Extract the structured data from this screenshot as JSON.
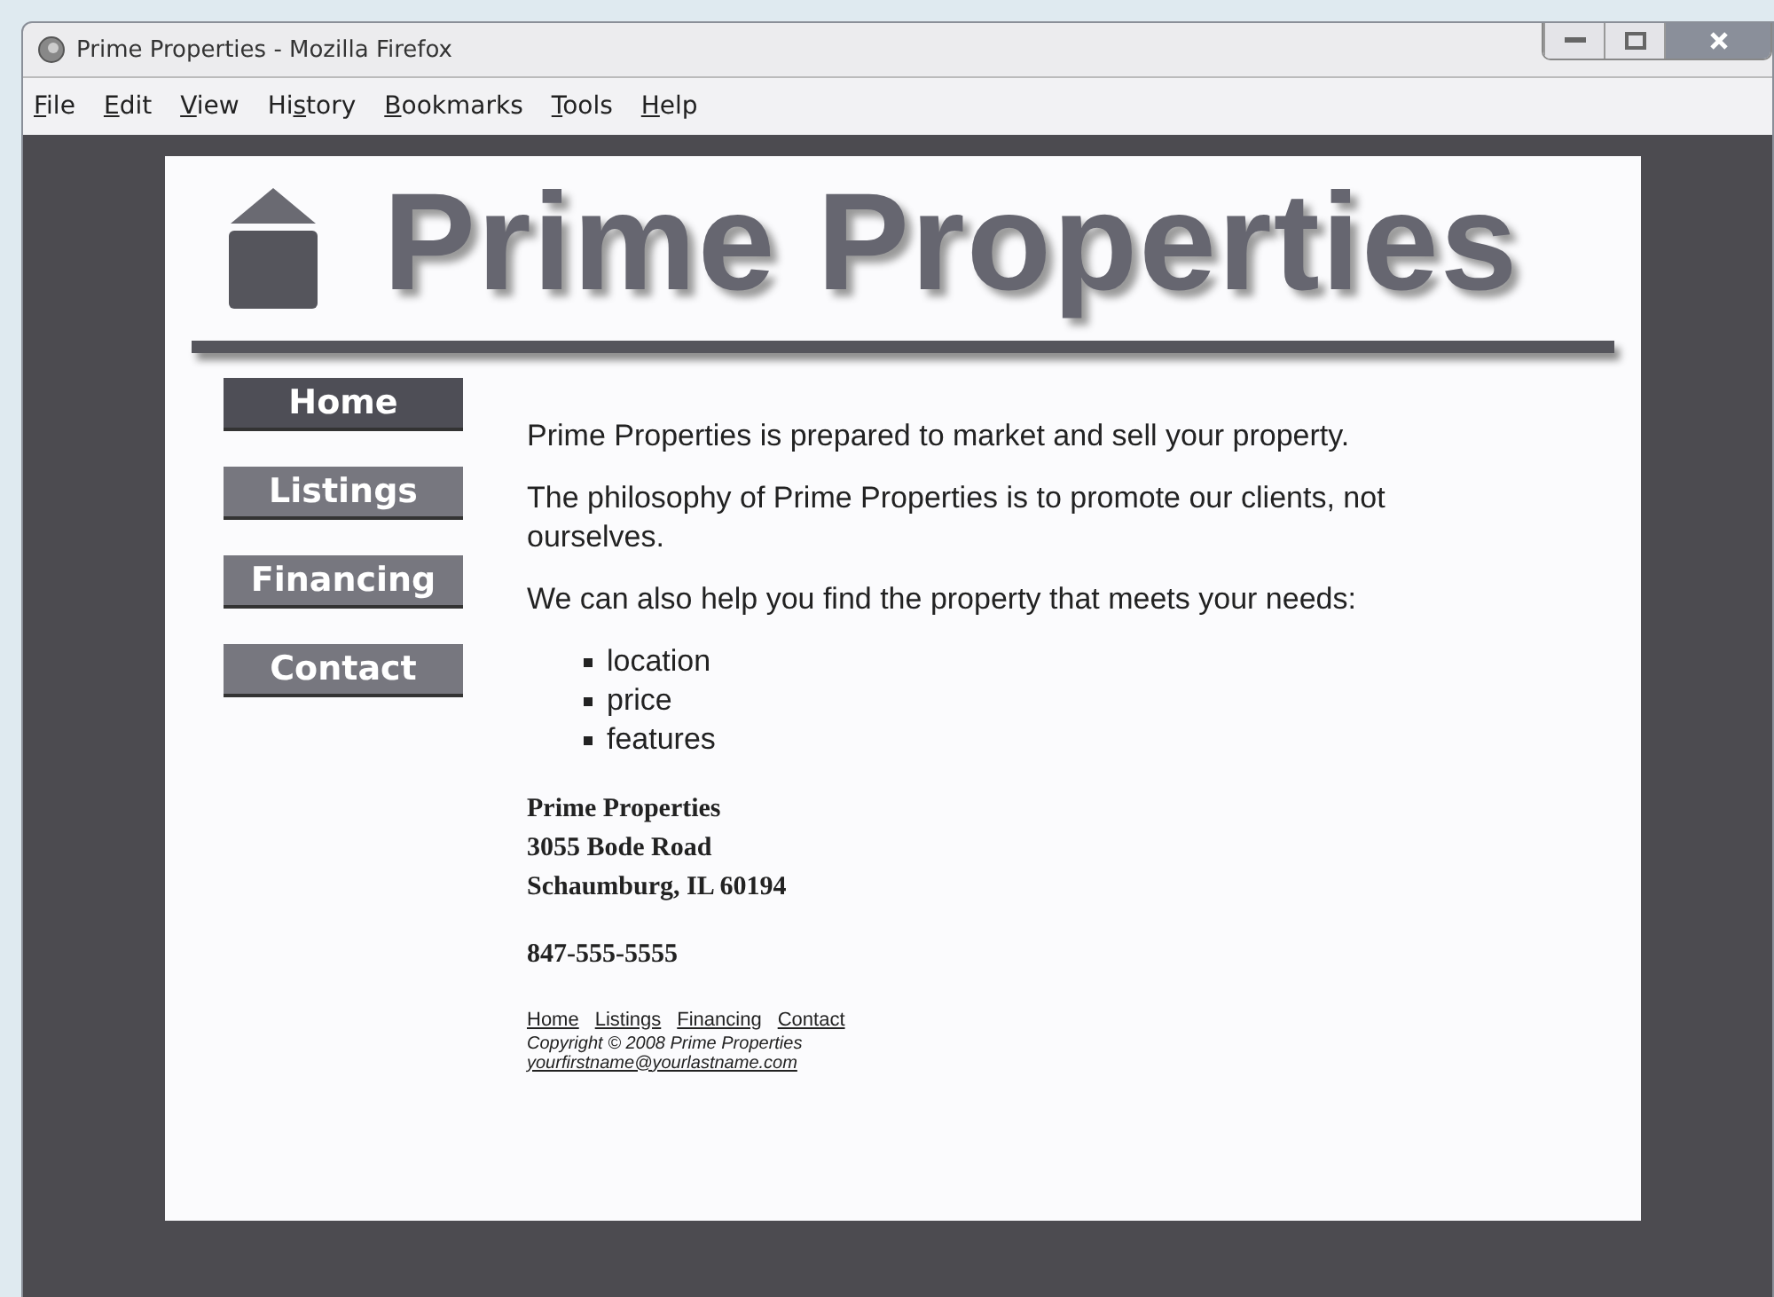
{
  "window": {
    "title": "Prime Properties - Mozilla Firefox"
  },
  "menu": [
    {
      "key": "F",
      "post": "ile"
    },
    {
      "key": "E",
      "post": "dit"
    },
    {
      "key": "V",
      "post": "iew"
    },
    {
      "pre": "Hi",
      "key": "s",
      "post": "tory"
    },
    {
      "key": "B",
      "post": "ookmarks"
    },
    {
      "key": "T",
      "post": "ools"
    },
    {
      "key": "H",
      "post": "elp"
    }
  ],
  "site_title": "Prime Properties",
  "nav": [
    {
      "label": "Home",
      "selected": true
    },
    {
      "label": "Listings",
      "selected": false
    },
    {
      "label": "Financing",
      "selected": false
    },
    {
      "label": "Contact",
      "selected": false
    }
  ],
  "paragraphs": [
    "Prime Properties is prepared to market and sell your property.",
    "The philosophy of Prime Properties is to promote our clients, not ourselves.",
    "We can also help you find the property that meets your needs:"
  ],
  "list": [
    "location",
    "price",
    "features"
  ],
  "address": [
    "Prime Properties",
    "3055 Bode Road",
    "Schaumburg, IL 60194"
  ],
  "phone": "847-555-5555",
  "footer": {
    "links": [
      "Home",
      "Listings",
      "Financing",
      "Contact"
    ],
    "copyright": "Copyright © 2008 Prime Properties",
    "email": "yourfirstname@yourlastname.com"
  }
}
